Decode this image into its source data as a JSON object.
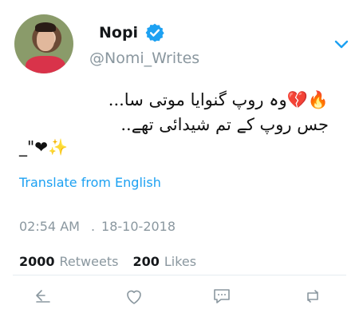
{
  "author": {
    "display_name": "Nopi",
    "handle": "@Nomi_Writes"
  },
  "tweet": {
    "line1": "🔥💔وہ روپ گنوایا موتی سا...",
    "line2": "جس روپ کے تم شیدائی تھے..",
    "line3": "_\"❤✨"
  },
  "translate_label": "Translate from English",
  "meta": {
    "time": "02:54 AM",
    "separator": ".",
    "date": "18-10-2018"
  },
  "stats": {
    "retweets_count": "2000",
    "retweets_label": "Retweets",
    "likes_count": "200",
    "likes_label": "Likes"
  },
  "icons": {
    "verified": "verified-badge-icon",
    "menu": "chevron-down-icon",
    "reply": "reply-icon",
    "like": "heart-icon",
    "comment": "comment-icon",
    "retweet": "retweet-icon"
  },
  "colors": {
    "accent": "#1da1f2",
    "muted": "#8a979f"
  }
}
